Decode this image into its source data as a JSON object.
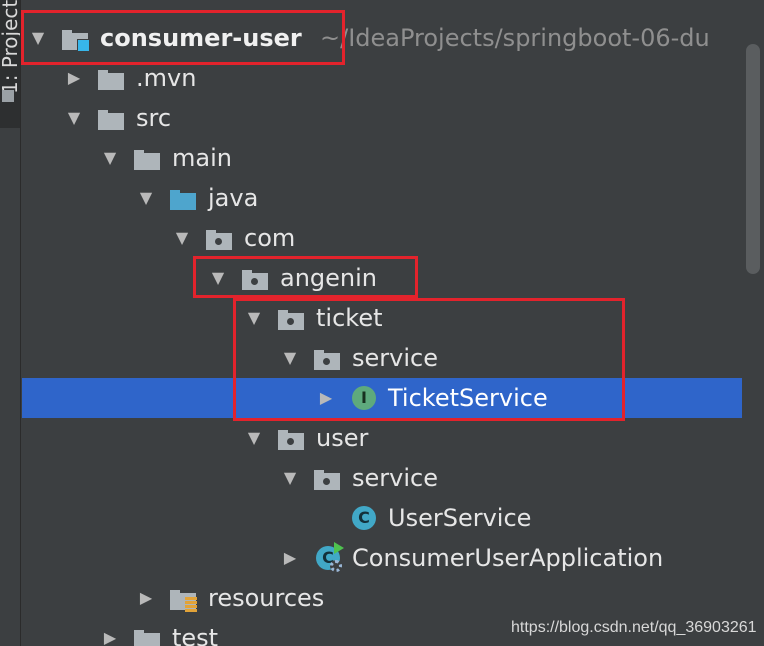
{
  "tool_window": {
    "tab_label": "1: Project"
  },
  "tree": {
    "root": {
      "label": "consumer-user",
      "path": "~/IdeaProjects/springboot-06-du"
    },
    "nodes": [
      {
        "id": "mvn",
        "label": ".mvn",
        "arrow": "▶"
      },
      {
        "id": "src",
        "label": "src",
        "arrow": "▼"
      },
      {
        "id": "main",
        "label": "main",
        "arrow": "▼"
      },
      {
        "id": "java",
        "label": "java",
        "arrow": "▼"
      },
      {
        "id": "com",
        "label": "com",
        "arrow": "▼"
      },
      {
        "id": "angenin",
        "label": "angenin",
        "arrow": "▼"
      },
      {
        "id": "ticket",
        "label": "ticket",
        "arrow": "▼"
      },
      {
        "id": "ticket-service",
        "label": "service",
        "arrow": "▼"
      },
      {
        "id": "ticketservice",
        "label": "TicketService",
        "arrow": "▶",
        "icon": "I",
        "selected": true
      },
      {
        "id": "user",
        "label": "user",
        "arrow": "▼"
      },
      {
        "id": "user-service",
        "label": "service",
        "arrow": "▼"
      },
      {
        "id": "userservice",
        "label": "UserService",
        "icon": "C"
      },
      {
        "id": "consumeruserapplication",
        "label": "ConsumerUserApplication",
        "arrow": "▶",
        "icon": "C"
      },
      {
        "id": "resources",
        "label": "resources",
        "arrow": "▶"
      },
      {
        "id": "test",
        "label": "test",
        "arrow": "▶"
      }
    ]
  },
  "root_arrow": "▼",
  "watermark": "https://blog.csdn.net/qq_36903261",
  "colors": {
    "background": "#3c3f41",
    "selection": "#2f65ca",
    "highlight_box": "#e3232c",
    "source_folder": "#4ea5cd",
    "folder": "#aeb5ba",
    "interface_icon": "#5eaa7d",
    "class_icon": "#41a8c7"
  },
  "icons": {
    "expand": "triangle-right-icon",
    "collapse": "triangle-down-icon",
    "module": "module-folder-icon",
    "folder": "folder-icon",
    "package": "package-icon",
    "source_root": "source-root-folder-icon",
    "resources_root": "resources-root-folder-icon",
    "interface": "interface-icon",
    "class": "class-icon",
    "spring_app": "spring-boot-application-icon"
  }
}
